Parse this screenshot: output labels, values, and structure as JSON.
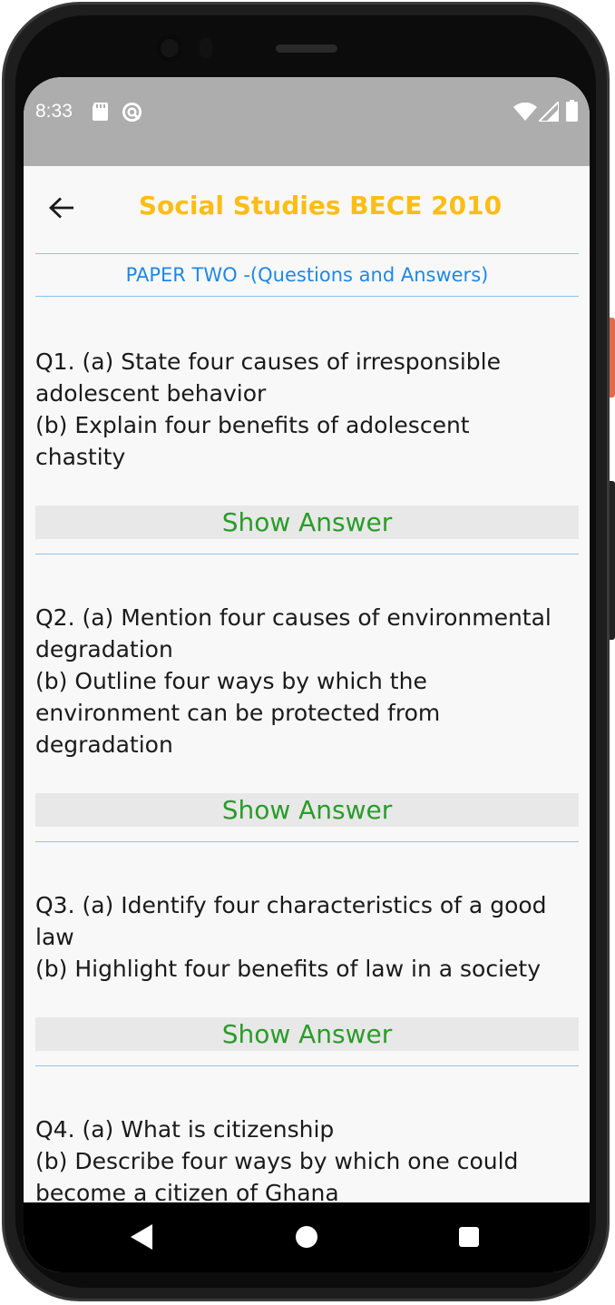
{
  "status_bar": {
    "time": "8:33",
    "icons": [
      "sd-card-icon",
      "sync-icon",
      "wifi-icon",
      "signal-icon",
      "battery-icon"
    ]
  },
  "app_bar": {
    "back_icon": "arrow-left-icon",
    "title": "Social Studies BECE 2010"
  },
  "paper_header": "PAPER TWO -(Questions and Answers)",
  "questions": [
    {
      "text": "Q1. (a) State four causes of irresponsible\nadolescent behavior\n(b) Explain four benefits of adolescent\nchastity",
      "button_label": "Show Answer"
    },
    {
      "text": "Q2. (a) Mention four causes of environmental\ndegradation\n(b) Outline four ways by which the\nenvironment can be protected from\ndegradation",
      "button_label": "Show Answer"
    },
    {
      "text": "Q3. (a) Identify four characteristics of a good\nlaw\n(b) Highlight four benefits of law in a society",
      "button_label": "Show Answer"
    },
    {
      "text": "Q4. (a) What is citizenship\n(b) Describe four ways by which one could\nbecome a citizen of Ghana"
    }
  ],
  "nav_bar": {
    "icons": [
      "nav-back-icon",
      "nav-home-icon",
      "nav-recents-icon"
    ]
  },
  "colors": {
    "title": "#fbbd16",
    "paper_header": "#1e88e5",
    "divider": "#90c3ea",
    "show_answer_text": "#2a9c2a",
    "show_answer_bg": "#e8e8e8",
    "status_bar": "#adadad"
  }
}
